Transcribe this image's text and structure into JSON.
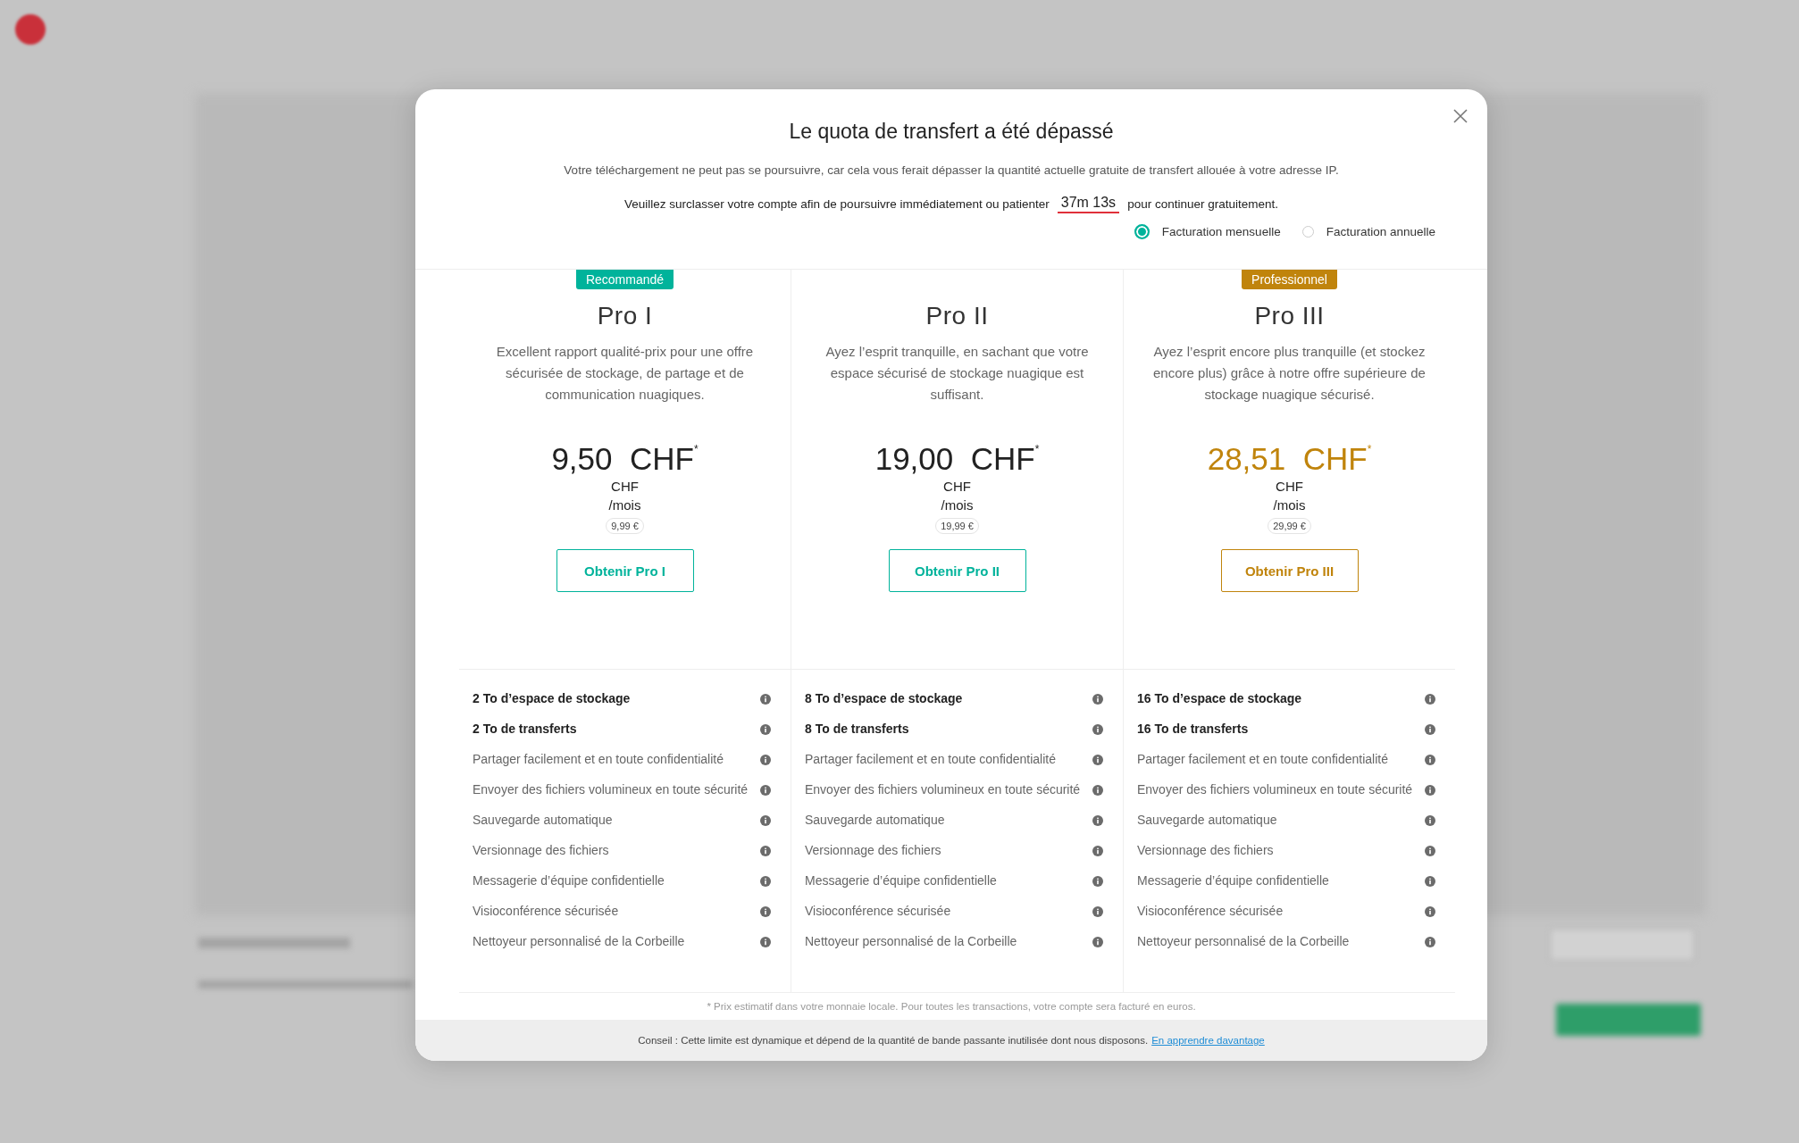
{
  "dialog": {
    "title": "Le quota de transfert a été dépassé",
    "message": "Votre téléchargement ne peut pas se poursuivre, car cela vous ferait dépasser la quantité actuelle gratuite de transfert allouée à votre adresse IP.",
    "wait_before": "Veuillez surclasser votre compte afin de poursuivre immédiatement ou patienter",
    "timer": "37m 13s",
    "wait_after": "pour continuer gratuitement.",
    "billing_options": [
      {
        "label": "Facturation mensuelle",
        "selected": true
      },
      {
        "label": "Facturation annuelle",
        "selected": false
      }
    ],
    "plans": [
      {
        "badge": "Recommandé",
        "name": "Pro I",
        "description": "Excellent rapport qualité-prix pour une offre sécurisée de stockage, de partage et de communication nuagiques.",
        "price": "9,50  CHF",
        "price_mark": "*",
        "price_highlighted": false,
        "currency": "CHF",
        "period": "/mois",
        "euro_price": "9,99 €",
        "button": "Obtenir Pro I",
        "color": "#00b39b",
        "features": [
          {
            "text": "2 To d’espace de stockage",
            "kind": "key"
          },
          {
            "text": "2 To de transferts",
            "kind": "key"
          },
          {
            "text": "Partager facilement et en toute confidentialité",
            "kind": "standard"
          },
          {
            "text": "Envoyer des fichiers volumineux en toute sécurité",
            "kind": "standard"
          },
          {
            "text": "Sauvegarde automatique",
            "kind": "standard"
          },
          {
            "text": "Versionnage des fichiers",
            "kind": "standard"
          },
          {
            "text": "Messagerie d’équipe confidentielle",
            "kind": "standard"
          },
          {
            "text": "Visioconférence sécurisée",
            "kind": "standard"
          },
          {
            "text": "Nettoyeur personnalisé de la Corbeille",
            "kind": "standard"
          }
        ]
      },
      {
        "name": "Pro II",
        "description": "Ayez l’esprit tranquille, en sachant que votre espace sécurisé de stockage nuagique est suffisant.",
        "price": "19,00  CHF",
        "price_mark": "*",
        "price_highlighted": false,
        "currency": "CHF",
        "period": "/mois",
        "euro_price": "19,99 €",
        "button": "Obtenir Pro II",
        "color": "#00b39b",
        "features": [
          {
            "text": "8 To d’espace de stockage",
            "kind": "key"
          },
          {
            "text": "8 To de transferts",
            "kind": "key"
          },
          {
            "text": "Partager facilement et en toute confidentialité",
            "kind": "standard"
          },
          {
            "text": "Envoyer des fichiers volumineux en toute sécurité",
            "kind": "standard"
          },
          {
            "text": "Sauvegarde automatique",
            "kind": "standard"
          },
          {
            "text": "Versionnage des fichiers",
            "kind": "standard"
          },
          {
            "text": "Messagerie d’équipe confidentielle",
            "kind": "standard"
          },
          {
            "text": "Visioconférence sécurisée",
            "kind": "standard"
          },
          {
            "text": "Nettoyeur personnalisé de la Corbeille",
            "kind": "standard"
          }
        ]
      },
      {
        "badge": "Professionnel",
        "name": "Pro III",
        "description": "Ayez l’esprit encore plus tranquille (et stockez encore plus) grâce à notre offre supérieure de stockage nuagique sécurisé.",
        "price": "28,51  CHF",
        "price_mark": "*",
        "price_highlighted": true,
        "currency": "CHF",
        "period": "/mois",
        "euro_price": "29,99 €",
        "button": "Obtenir Pro III",
        "color": "#c0840c",
        "features": [
          {
            "text": "16 To d’espace de stockage",
            "kind": "key"
          },
          {
            "text": "16 To de transferts",
            "kind": "key"
          },
          {
            "text": "Partager facilement et en toute confidentialité",
            "kind": "standard"
          },
          {
            "text": "Envoyer des fichiers volumineux en toute sécurité",
            "kind": "standard"
          },
          {
            "text": "Sauvegarde automatique",
            "kind": "standard"
          },
          {
            "text": "Versionnage des fichiers",
            "kind": "standard"
          },
          {
            "text": "Messagerie d’équipe confidentielle",
            "kind": "standard"
          },
          {
            "text": "Visioconférence sécurisée",
            "kind": "standard"
          },
          {
            "text": "Nettoyeur personnalisé de la Corbeille",
            "kind": "standard"
          }
        ]
      }
    ],
    "footnote": "* Prix estimatif dans votre monnaie locale. Pour toutes les transactions, votre compte sera facturé en euros.",
    "tip": "Conseil : Cette limite est dynamique et dépend de la quantité de bande passante inutilisée dont nous disposons.",
    "tip_link": "En apprendre davantage"
  }
}
